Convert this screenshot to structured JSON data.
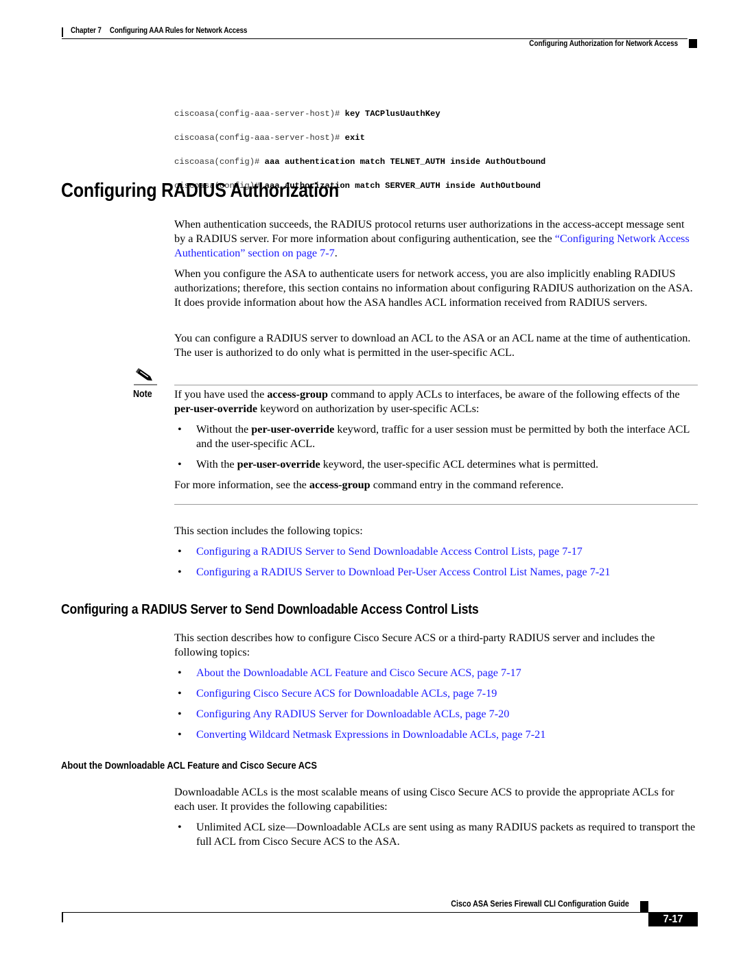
{
  "header": {
    "chapter_label": "Chapter 7",
    "chapter_title": "Configuring AAA Rules for Network Access",
    "section_title": "Configuring Authorization for Network Access"
  },
  "code_block": [
    {
      "prompt": "ciscoasa(config-aaa-server-host)# ",
      "command": "key TACPlusUauthKey"
    },
    {
      "prompt": "ciscoasa(config-aaa-server-host)# ",
      "command": "exit"
    },
    {
      "prompt": "ciscoasa(config)# ",
      "command": "aaa authentication match TELNET_AUTH inside AuthOutbound"
    },
    {
      "prompt": "ciscoasa(config)# ",
      "command": "aaa authorization match SERVER_AUTH inside AuthOutbound"
    }
  ],
  "section1": {
    "heading": "Configuring RADIUS Authorization",
    "para1_text": "When authentication succeeds, the RADIUS protocol returns user authorizations in the access-accept message sent by a RADIUS server. For more information about configuring authentication, see the ",
    "para1_link": "“Configuring Network Access Authentication” section on page 7-7",
    "para1_end": ".",
    "para2": "When you configure the ASA to authenticate users for network access, you are also implicitly enabling RADIUS authorizations; therefore, this section contains no information about configuring RADIUS authorization on the ASA. It does provide information about how the ASA handles ACL information received from RADIUS servers.",
    "para3": "You can configure a RADIUS server to download an ACL to the ASA or an ACL name at the time of authentication. The user is authorized to do only what is permitted in the user-specific ACL."
  },
  "note": {
    "label": "Note",
    "icon": "pencil-note-icon",
    "intro_a": "If you have used the ",
    "intro_b1": "access-group",
    "intro_c": " command to apply ACLs to interfaces, be aware of the following effects of the ",
    "intro_b2": "per-user-override",
    "intro_d": " keyword on authorization by user-specific ACLs:",
    "bullets": [
      {
        "pre": "Without the ",
        "bold": "per-user-override",
        "post": " keyword, traffic for a user session must be permitted by both the interface ACL and the user-specific ACL."
      },
      {
        "pre": "With the ",
        "bold": "per-user-override",
        "post": " keyword, the user-specific ACL determines what is permitted."
      }
    ],
    "outro_a": "For more information, see the ",
    "outro_b": "access-group",
    "outro_c": " command entry in the command reference."
  },
  "topics": {
    "intro": "This section includes the following topics:",
    "links": [
      "Configuring a RADIUS Server to Send Downloadable Access Control Lists, page 7-17",
      "Configuring a RADIUS Server to Download Per-User Access Control List Names, page 7-21"
    ]
  },
  "section2": {
    "heading": "Configuring a RADIUS Server to Send Downloadable Access Control Lists",
    "intro": "This section describes how to configure Cisco Secure ACS or a third-party RADIUS server and includes the following topics:",
    "links": [
      "About the Downloadable ACL Feature and Cisco Secure ACS, page 7-17",
      "Configuring Cisco Secure ACS for Downloadable ACLs, page 7-19",
      "Configuring Any RADIUS Server for Downloadable ACLs, page 7-20",
      "Converting Wildcard Netmask Expressions in Downloadable ACLs, page 7-21"
    ]
  },
  "section3": {
    "heading": "About the Downloadable ACL Feature and Cisco Secure ACS",
    "para1": "Downloadable ACLs is the most scalable means of using Cisco Secure ACS to provide the appropriate ACLs for each user. It provides the following capabilities:",
    "bullets": [
      "Unlimited ACL size—Downloadable ACLs are sent using as many RADIUS packets as required to transport the full ACL from Cisco Secure ACS to the ASA."
    ]
  },
  "footer": {
    "guide_title": "Cisco ASA Series Firewall CLI Configuration Guide",
    "page_number": "7-17"
  },
  "colors": {
    "link": "#1a1aff",
    "text": "#000000"
  }
}
